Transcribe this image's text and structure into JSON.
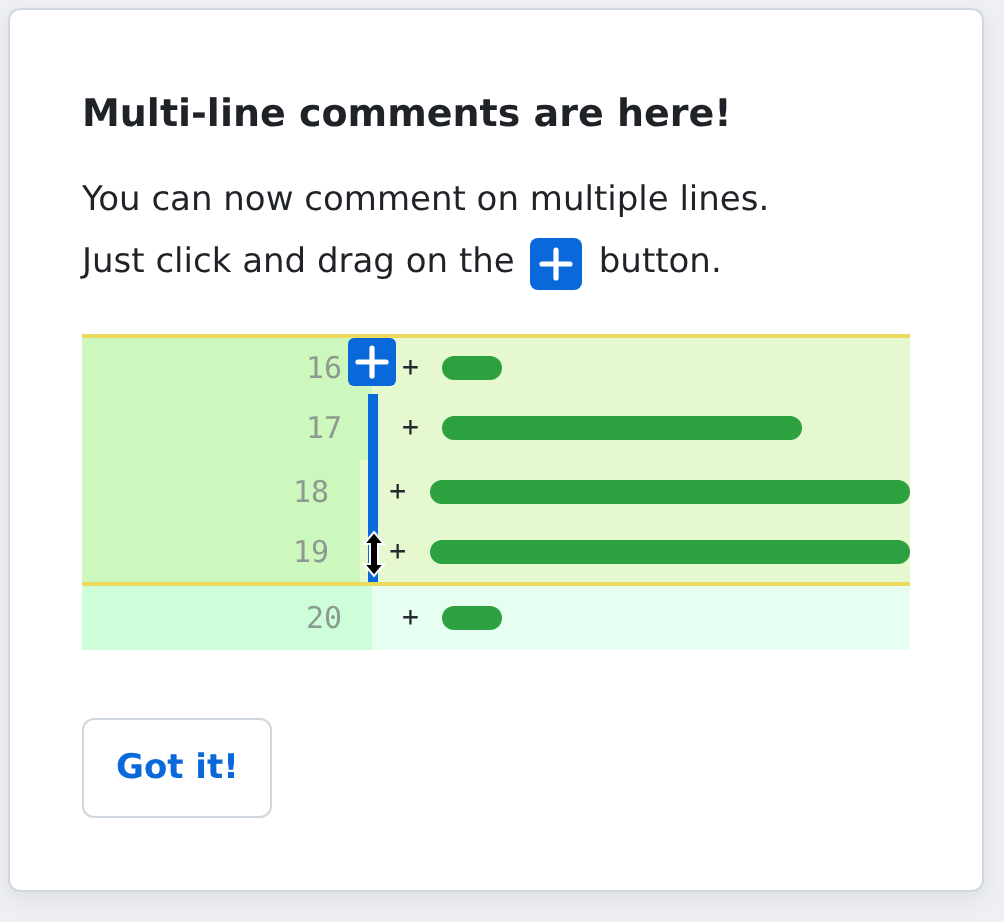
{
  "title": "Multi-line comments are here!",
  "body": {
    "line_1": "You can now comment on multiple lines.",
    "line_2_before": "Just click and drag on the",
    "line_2_after": "button."
  },
  "diff_lines": [
    {
      "number": "16",
      "sign": "+",
      "selected": true
    },
    {
      "number": "17",
      "sign": "+",
      "selected": true
    },
    {
      "number": "18",
      "sign": "+",
      "selected": true
    },
    {
      "number": "19",
      "sign": "+",
      "selected": true
    },
    {
      "number": "20",
      "sign": "+",
      "selected": false
    }
  ],
  "button": "Got it!"
}
